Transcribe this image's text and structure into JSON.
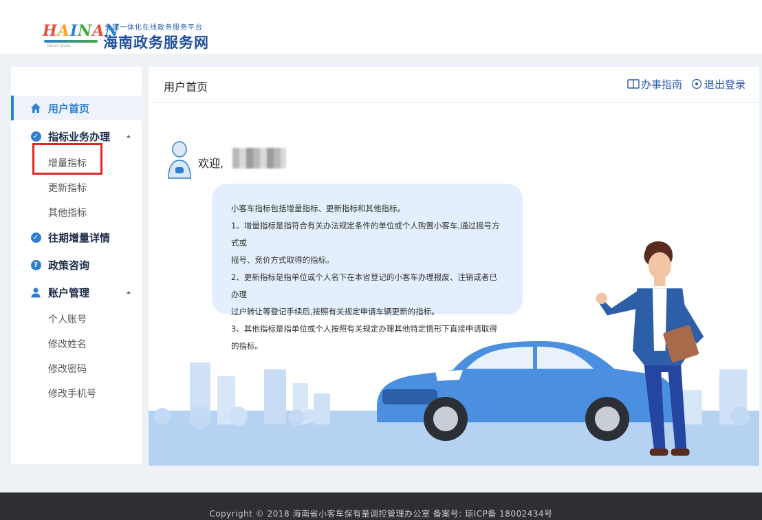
{
  "header": {
    "logo_text": "HAINAN",
    "logo_subtext": "Hainan Island...",
    "subtitle": "全国一体化在线政务服务平台",
    "title": "海南政务服务网"
  },
  "sidebar": {
    "items": [
      {
        "label": "用户首页",
        "icon": "home-icon",
        "active": true
      },
      {
        "label": "指标业务办理",
        "icon": "check-circle-icon",
        "expanded": true,
        "children": [
          {
            "label": "增量指标"
          },
          {
            "label": "更新指标"
          },
          {
            "label": "其他指标"
          }
        ]
      },
      {
        "label": "往期增量详情",
        "icon": "check-circle-icon"
      },
      {
        "label": "政策咨询",
        "icon": "question-circle-icon"
      },
      {
        "label": "账户管理",
        "icon": "user-icon",
        "expanded": true,
        "children": [
          {
            "label": "个人账号"
          },
          {
            "label": "修改姓名"
          },
          {
            "label": "修改密码"
          },
          {
            "label": "修改手机号"
          }
        ]
      }
    ]
  },
  "main": {
    "title": "用户首页",
    "guide_link": "办事指南",
    "logout_link": "退出登录",
    "welcome": "欢迎,",
    "info_lines": [
      "小客车指标包括增量指标、更新指标和其他指标。",
      "1、增量指标是指符合有关办法规定条件的单位或个人购置小客车,通过摇号方式或",
      "摇号、竞价方式取得的指标。",
      "2、更新指标是指单位或个人名下在本省登记的小客车办理报废、注销或者已办理",
      "过户转让等登记手续后,按照有关规定申请车辆更新的指标。",
      "3、其他指标是指单位或个人按照有关规定办理其他特定情形下直接申请取得的指标。"
    ]
  },
  "footer": {
    "text": "Copyright © 2018 海南省小客车保有量调控管理办公室 备案号: 琼ICP备 18002434号"
  },
  "colors": {
    "accent": "#2f7fd0",
    "highlight": "#e3261f",
    "footer_bg": "#2e2f33"
  }
}
